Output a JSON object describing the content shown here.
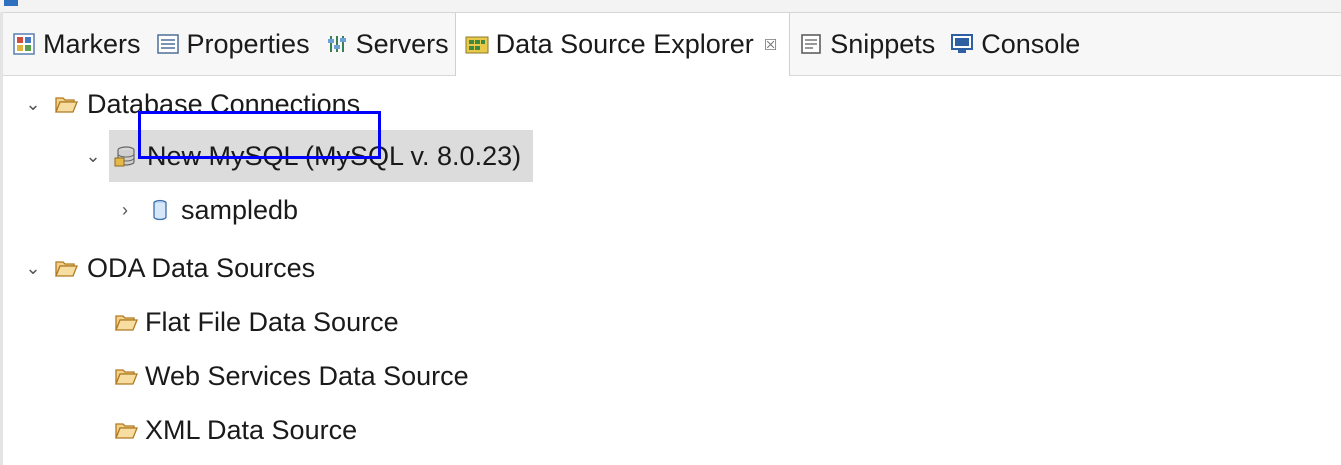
{
  "tabs": [
    {
      "label": "Markers",
      "icon": "markers-icon"
    },
    {
      "label": "Properties",
      "icon": "properties-icon"
    },
    {
      "label": "Servers",
      "icon": "servers-icon"
    },
    {
      "label": "Data Source Explorer",
      "icon": "data-source-explorer-icon",
      "active": true,
      "close": "☒"
    },
    {
      "label": "Snippets",
      "icon": "snippets-icon"
    },
    {
      "label": "Console",
      "icon": "console-icon"
    }
  ],
  "tree": {
    "database_connections": {
      "label": "Database Connections",
      "expanded": true
    },
    "mysql_connection": {
      "label": "New MySQL (MySQL v. 8.0.23)",
      "expanded": true
    },
    "sampledb": {
      "label": "sampledb",
      "expanded": false
    },
    "oda_data_sources": {
      "label": "ODA Data Sources",
      "expanded": true
    },
    "flat_file": {
      "label": "Flat File Data Source"
    },
    "web_services": {
      "label": "Web Services Data Source"
    },
    "xml": {
      "label": "XML Data Source"
    }
  },
  "glyphs": {
    "expanded": "⌄",
    "collapsed": "›"
  },
  "colors": {
    "highlight_border": "#0000ff",
    "selection_bg": "#dcdcdc",
    "folder": "#c98f2e"
  }
}
